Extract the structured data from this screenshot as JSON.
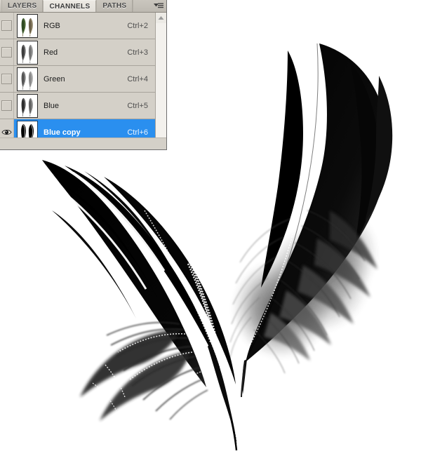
{
  "app": {
    "panel_title": "Channels Panel"
  },
  "panel": {
    "tabs": [
      {
        "label": "LAYERS",
        "active": false,
        "name": "tab-layers"
      },
      {
        "label": "CHANNELS",
        "active": true,
        "name": "tab-channels"
      },
      {
        "label": "PATHS",
        "active": false,
        "name": "tab-paths"
      }
    ],
    "menu_icon": "panel-menu-icon",
    "scroll_up_icon": "scroll-up-arrow-icon",
    "colors": {
      "panel_bg": "#d4d0c8",
      "tab_active_bg": "#ece9e3",
      "selection_blue": "#2a8fef",
      "text": "#1c1c1c",
      "selected_text": "#ffffff"
    },
    "channels": [
      {
        "name": "RGB",
        "shortcut": "Ctrl+2",
        "visible": false,
        "selected": false,
        "thumb_kind": "color",
        "eye_icon": "eye-icon"
      },
      {
        "name": "Red",
        "shortcut": "Ctrl+3",
        "visible": false,
        "selected": false,
        "thumb_kind": "gray-mid",
        "eye_icon": "eye-icon"
      },
      {
        "name": "Green",
        "shortcut": "Ctrl+4",
        "visible": false,
        "selected": false,
        "thumb_kind": "gray-light",
        "eye_icon": "eye-icon"
      },
      {
        "name": "Blue",
        "shortcut": "Ctrl+5",
        "visible": false,
        "selected": false,
        "thumb_kind": "gray-dark",
        "eye_icon": "eye-icon"
      },
      {
        "name": "Blue copy",
        "shortcut": "Ctrl+6",
        "visible": true,
        "selected": true,
        "thumb_kind": "bw",
        "eye_icon": "eye-icon"
      }
    ]
  },
  "canvas": {
    "name": "image-canvas",
    "background": "#ffffff",
    "subject": "two-black-feathers",
    "description": "High-contrast black-and-white photo of two dark feathers arranged in a V shape on a white background"
  }
}
